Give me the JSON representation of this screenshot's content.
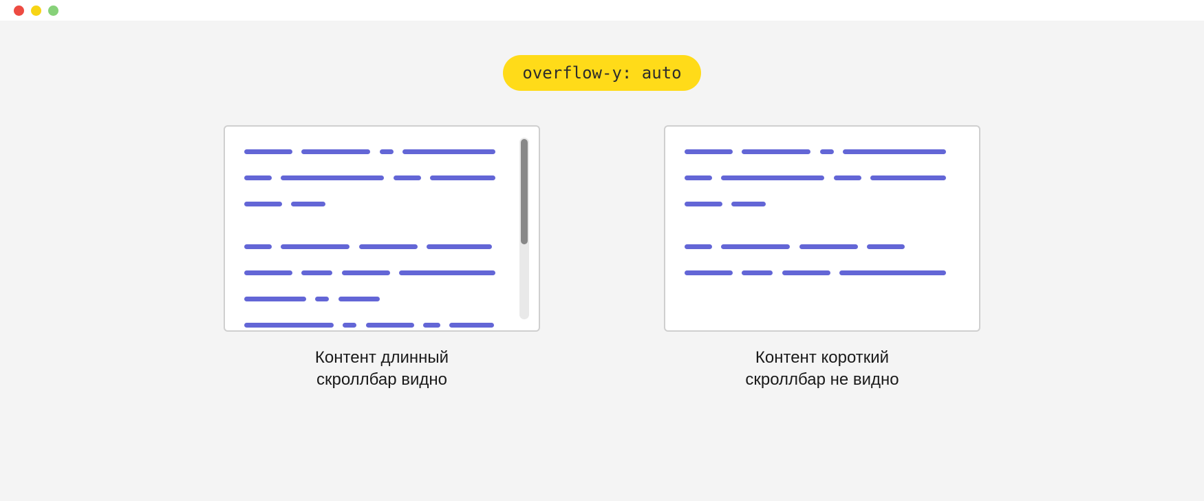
{
  "header": {
    "pill_label": "overflow-y: auto"
  },
  "panels": {
    "left": {
      "caption_line1": "Контент длинный",
      "caption_line2": "скроллбар видно"
    },
    "right": {
      "caption_line1": "Контент короткий",
      "caption_line2": "скроллбар не видно"
    }
  },
  "colors": {
    "accent_yellow": "#ffdb19",
    "text_line": "#6366d6",
    "scrollbar_thumb": "#888888",
    "scrollbar_track": "#e9e9e9"
  }
}
